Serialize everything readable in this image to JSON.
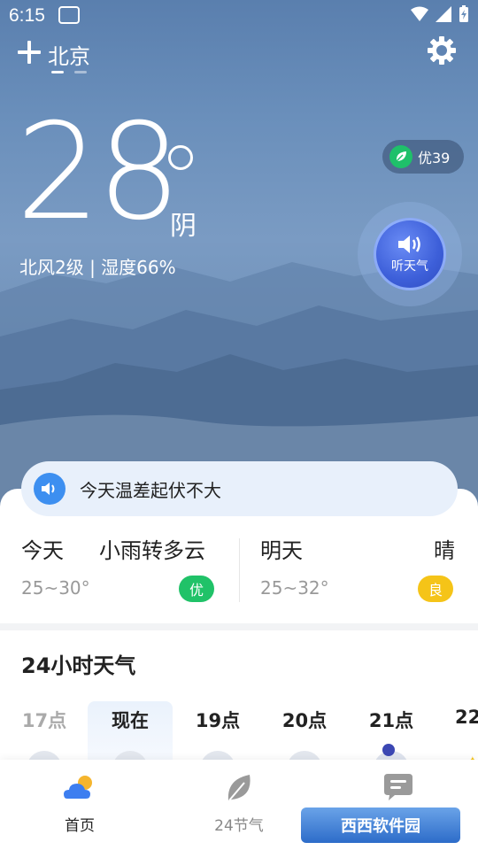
{
  "status_bar": {
    "time": "6:15"
  },
  "header": {
    "city": "北京"
  },
  "current": {
    "temperature": "28",
    "condition": "阴",
    "wind_humidity": "北风2级 | 湿度66%",
    "aqi": "优39",
    "listen_label": "听天气"
  },
  "notice": {
    "text": "今天温差起伏不大"
  },
  "forecast": {
    "today": {
      "day": "今天",
      "weather": "小雨转多云",
      "range": "25~30°",
      "aqi": "优",
      "aqi_color": "#20c268"
    },
    "tomorrow": {
      "day": "明天",
      "weather": "晴",
      "range": "25~32°",
      "aqi": "良",
      "aqi_color": "#f5c418"
    }
  },
  "hourly": {
    "title": "24小时天气",
    "hours": [
      {
        "label": "17点",
        "icon": "cloudy-icon",
        "past": true
      },
      {
        "label": "现在",
        "icon": "cloudy-icon",
        "now": true
      },
      {
        "label": "19点",
        "icon": "cloudy-icon"
      },
      {
        "label": "20点",
        "icon": "cloudy-icon"
      },
      {
        "label": "21点",
        "icon": "moon-cloud-icon"
      },
      {
        "label": "22",
        "icon": "moon-icon"
      }
    ]
  },
  "bottom_nav": {
    "items": [
      {
        "label": "首页",
        "icon": "weather-home-icon",
        "active": true
      },
      {
        "label": "24节气",
        "icon": "leaf-icon"
      },
      {
        "label": "",
        "icon": "chat-icon"
      }
    ]
  },
  "watermark": {
    "text": "西西软件园"
  },
  "colors": {
    "accent": "#3d8ff0",
    "aqi_good": "#20c268",
    "aqi_fair": "#f5c418"
  }
}
